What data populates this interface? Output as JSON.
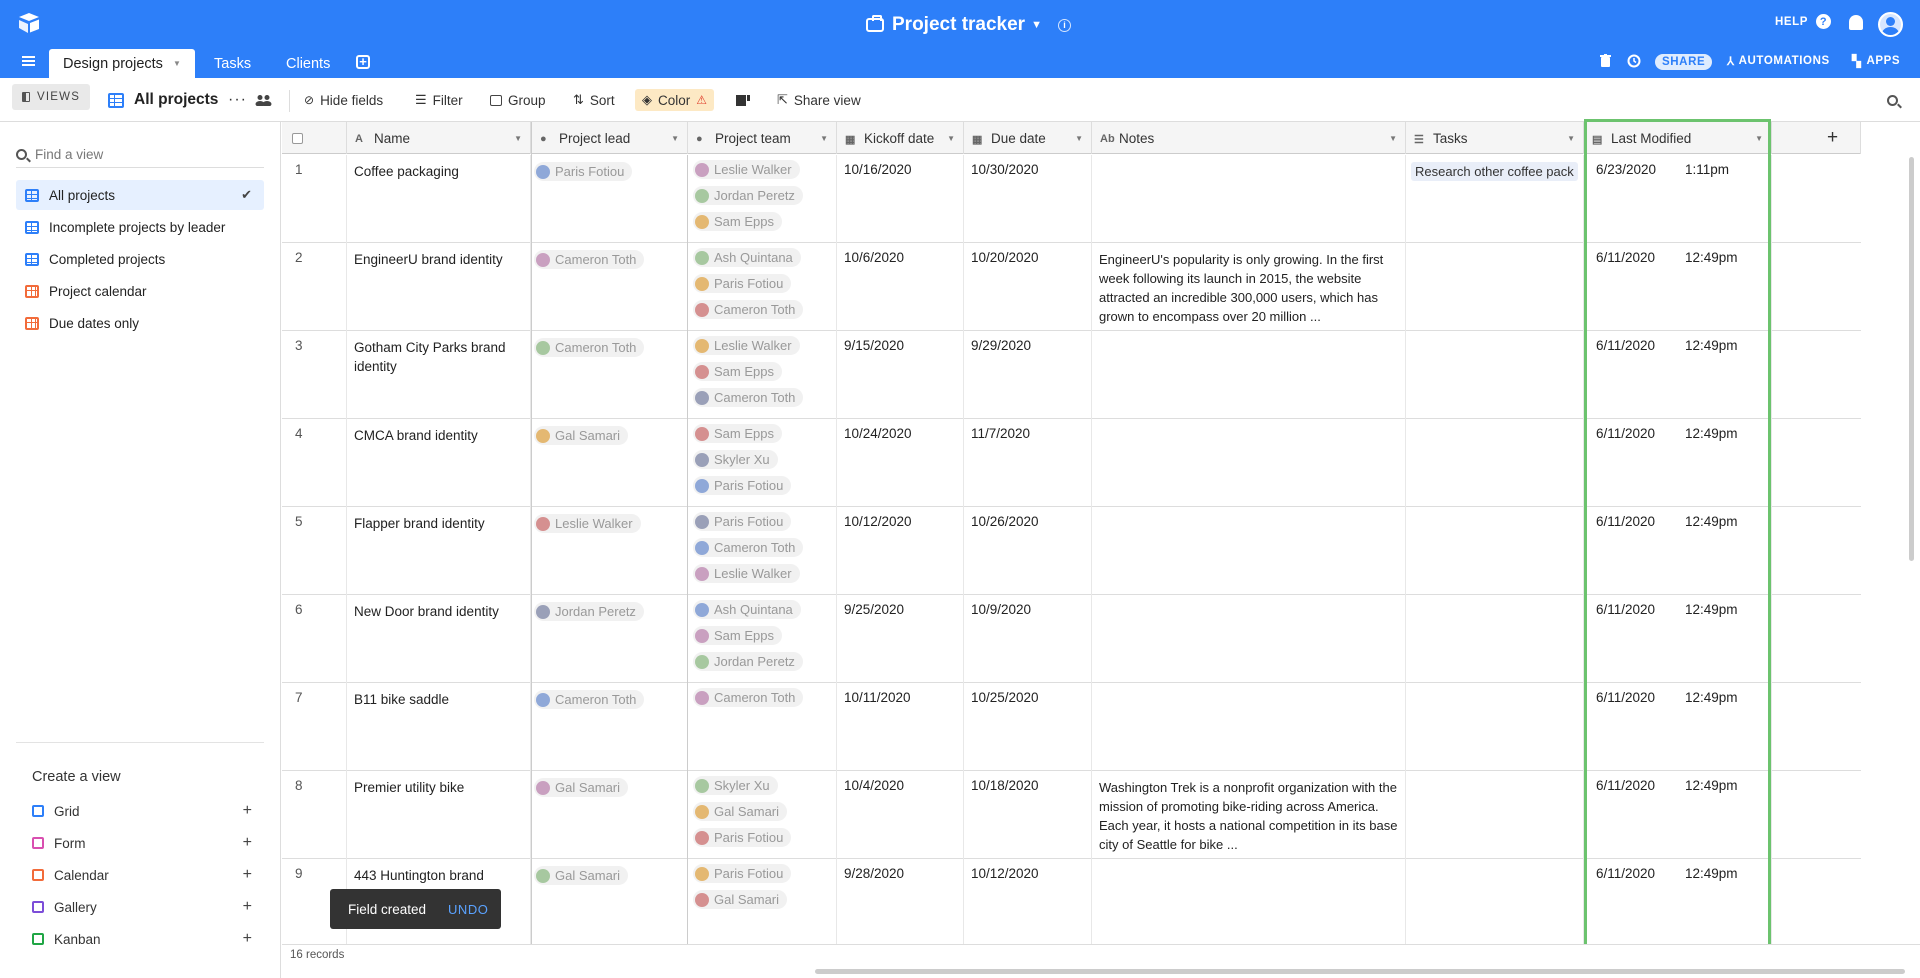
{
  "app": {
    "title": "Project tracker",
    "help_label": "HELP",
    "share_label": "SHARE",
    "automations_label": "AUTOMATIONS",
    "apps_label": "APPS"
  },
  "tabs": [
    {
      "label": "Design projects",
      "active": true
    },
    {
      "label": "Tasks",
      "active": false
    },
    {
      "label": "Clients",
      "active": false
    }
  ],
  "toolbar": {
    "views_label": "VIEWS",
    "current_view": "All projects",
    "hide_fields": "Hide fields",
    "filter": "Filter",
    "group": "Group",
    "sort": "Sort",
    "color": "Color",
    "share_view": "Share view"
  },
  "sidebar": {
    "search_placeholder": "Find a view",
    "views": [
      {
        "label": "All projects",
        "icon": "grid-icon",
        "selected": true
      },
      {
        "label": "Incomplete projects by leader",
        "icon": "grid-icon",
        "selected": false
      },
      {
        "label": "Completed projects",
        "icon": "grid-icon",
        "selected": false
      },
      {
        "label": "Project calendar",
        "icon": "calendar-icon",
        "selected": false
      },
      {
        "label": "Due dates only",
        "icon": "calendar-icon",
        "selected": false
      }
    ],
    "create_title": "Create a view",
    "create_items": [
      {
        "label": "Grid",
        "color": "#2d7ff9"
      },
      {
        "label": "Form",
        "color": "#d94fb0"
      },
      {
        "label": "Calendar",
        "color": "#f26b3a"
      },
      {
        "label": "Gallery",
        "color": "#7c4dd8"
      },
      {
        "label": "Kanban",
        "color": "#20a645"
      }
    ]
  },
  "columns": [
    "Name",
    "Project lead",
    "Project team",
    "Kickoff date",
    "Due date",
    "Notes",
    "Tasks",
    "Last Modified"
  ],
  "rows": [
    {
      "n": "1",
      "name": "Coffee packaging",
      "lead": "Paris Fotiou",
      "team": [
        "Leslie Walker",
        "Jordan Peretz",
        "Sam Epps"
      ],
      "kickoff": "10/16/2020",
      "due": "10/30/2020",
      "notes": "",
      "tasks": "Research other coffee pack",
      "lm_date": "6/23/2020",
      "lm_time": "1:11pm"
    },
    {
      "n": "2",
      "name": "EngineerU brand identity",
      "lead": "Cameron Toth",
      "team": [
        "Ash Quintana",
        "Paris Fotiou",
        "Cameron Toth"
      ],
      "kickoff": "10/6/2020",
      "due": "10/20/2020",
      "notes": "EngineerU's popularity is only growing. In the first week following its launch in 2015, the website attracted an incredible 300,000 users, which has grown to encompass over 20 million ...",
      "tasks": "",
      "lm_date": "6/11/2020",
      "lm_time": "12:49pm"
    },
    {
      "n": "3",
      "name": "Gotham City Parks brand identity",
      "lead": "Cameron Toth",
      "team": [
        "Leslie Walker",
        "Sam Epps",
        "Cameron Toth"
      ],
      "kickoff": "9/15/2020",
      "due": "9/29/2020",
      "notes": "",
      "tasks": "",
      "lm_date": "6/11/2020",
      "lm_time": "12:49pm"
    },
    {
      "n": "4",
      "name": "CMCA brand identity",
      "lead": "Gal Samari",
      "team": [
        "Sam Epps",
        "Skyler Xu",
        "Paris Fotiou"
      ],
      "kickoff": "10/24/2020",
      "due": "11/7/2020",
      "notes": "",
      "tasks": "",
      "lm_date": "6/11/2020",
      "lm_time": "12:49pm"
    },
    {
      "n": "5",
      "name": "Flapper brand identity",
      "lead": "Leslie Walker",
      "team": [
        "Paris Fotiou",
        "Cameron Toth",
        "Leslie Walker"
      ],
      "kickoff": "10/12/2020",
      "due": "10/26/2020",
      "notes": "",
      "tasks": "",
      "lm_date": "6/11/2020",
      "lm_time": "12:49pm"
    },
    {
      "n": "6",
      "name": "New Door brand identity",
      "lead": "Jordan Peretz",
      "team": [
        "Ash Quintana",
        "Sam Epps",
        "Jordan Peretz"
      ],
      "kickoff": "9/25/2020",
      "due": "10/9/2020",
      "notes": "",
      "tasks": "",
      "lm_date": "6/11/2020",
      "lm_time": "12:49pm"
    },
    {
      "n": "7",
      "name": "B11 bike saddle",
      "lead": "Cameron Toth",
      "team": [
        "Cameron Toth"
      ],
      "kickoff": "10/11/2020",
      "due": "10/25/2020",
      "notes": "",
      "tasks": "",
      "lm_date": "6/11/2020",
      "lm_time": "12:49pm"
    },
    {
      "n": "8",
      "name": "Premier utility bike",
      "lead": "Gal Samari",
      "team": [
        "Skyler Xu",
        "Gal Samari",
        "Paris Fotiou"
      ],
      "kickoff": "10/4/2020",
      "due": "10/18/2020",
      "notes": "Washington Trek is a nonprofit organization with the mission of promoting bike-riding across America. Each year, it hosts a national competition in its base city of Seattle for bike ...",
      "tasks": "",
      "lm_date": "6/11/2020",
      "lm_time": "12:49pm"
    },
    {
      "n": "9",
      "name": "443 Huntington brand",
      "lead": "Gal Samari",
      "team": [
        "Paris Fotiou",
        "Gal Samari"
      ],
      "kickoff": "9/28/2020",
      "due": "10/12/2020",
      "notes": "",
      "tasks": "",
      "lm_date": "6/11/2020",
      "lm_time": "12:49pm"
    }
  ],
  "footer": {
    "records": "16 records"
  },
  "toast": {
    "text": "Field created",
    "action": "UNDO"
  },
  "colors": {
    "topbar": "#2d7ff9",
    "highlight": "#6cc36e",
    "avatar": "#8fa8d8"
  }
}
